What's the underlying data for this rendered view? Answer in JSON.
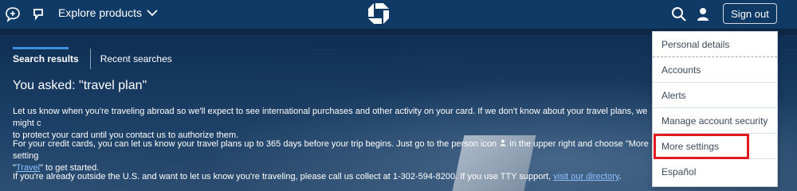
{
  "topbar": {
    "explore_label": "Explore products",
    "signout_label": "Sign out",
    "icons": [
      "chat-icon",
      "rewards-icon",
      "chevron-down-icon",
      "chase-logo",
      "search-icon",
      "person-icon"
    ]
  },
  "tabs": [
    {
      "label": "Search results",
      "active": true
    },
    {
      "label": "Recent searches",
      "active": false
    }
  ],
  "content": {
    "asked": "You asked: \"travel plan\"",
    "p1_line1": "Let us know when you're traveling abroad so we'll expect to see international purchases and other activity on your card. If we don't know about your travel plans, we might c",
    "p1_line2": "to protect your card until you contact us to authorize them.",
    "p2_line1_a": "For your credit cards, you can let us know your travel plans up to 365 days before your trip begins. Just go to the person icon",
    "p2_line1_b": "in the upper right and choose \"More setting",
    "p2_line2_pre": "\"",
    "p2_link": "Travel",
    "p2_line2_post": "\" to get started.",
    "p3_pre": "If you're already outside the U.S. and want to let us know you're traveling, please call us collect at 1-302-594-8200. If you use TTY support,",
    "p3_link": "visit our directory",
    "p3_post": "."
  },
  "menu": {
    "items": [
      "Personal details",
      "Accounts",
      "Alerts",
      "Manage account security",
      "More settings",
      "Español"
    ],
    "highlighted": "More settings",
    "highlight_color": "#e21b23"
  },
  "colors": {
    "topbar_bg": "#0f3a66",
    "link": "#8ec2ff"
  }
}
